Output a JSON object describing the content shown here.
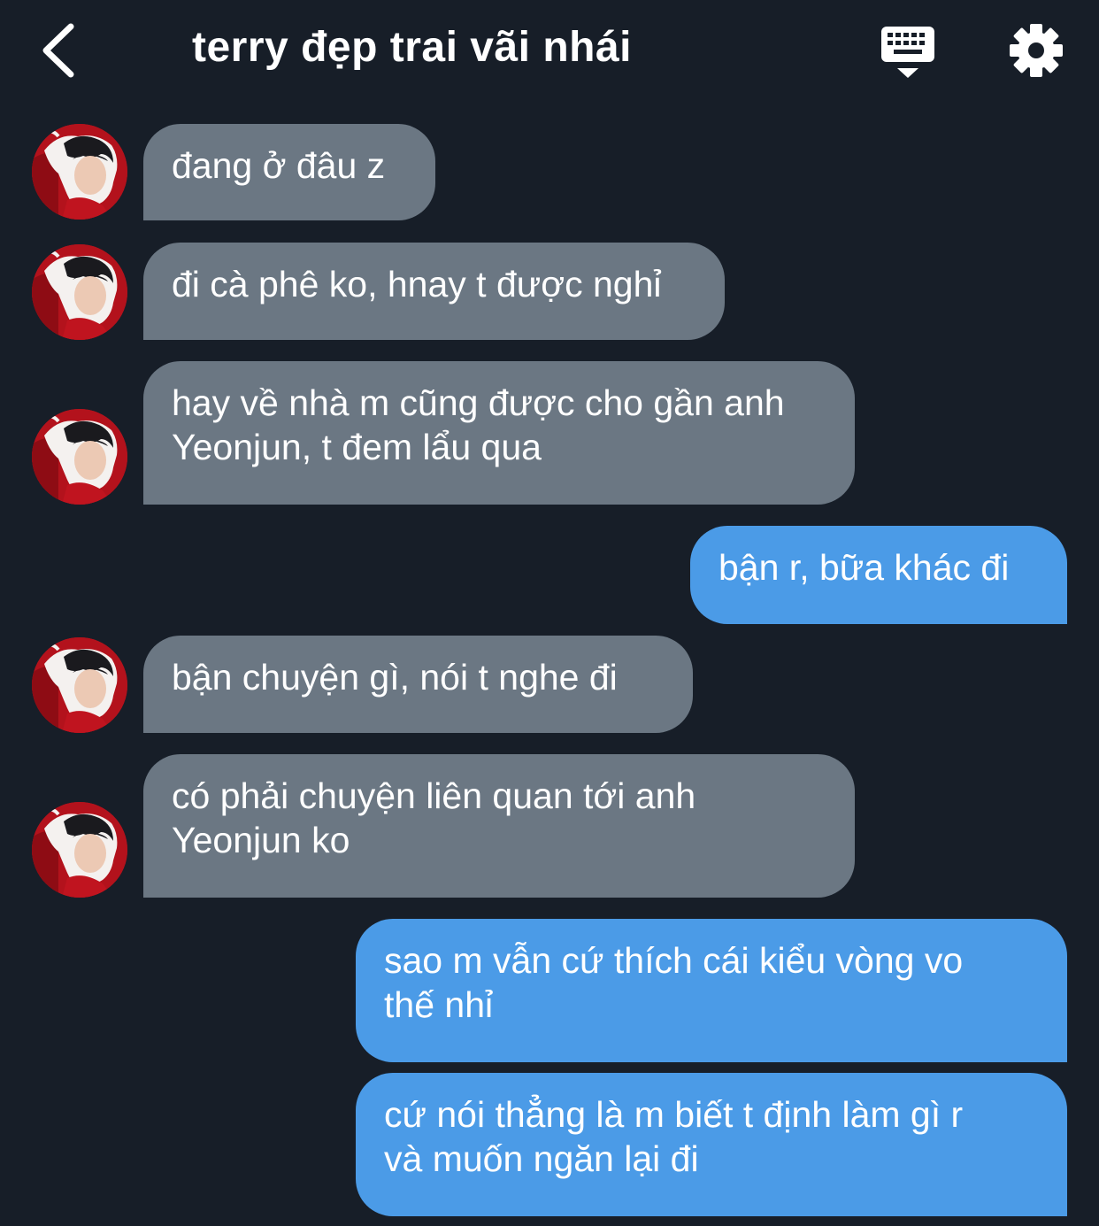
{
  "header": {
    "title": "terry đẹp trai vãi nhái",
    "back_icon": "chevron-left-icon",
    "keyboard_icon": "keyboard-icon",
    "settings_icon": "gear-icon"
  },
  "colors": {
    "background": "#171e28",
    "incoming_bubble": "#6b7783",
    "outgoing_bubble": "#4b9be7",
    "text": "#ffffff"
  },
  "messages": [
    {
      "direction": "incoming",
      "text": "đang ở đâu z"
    },
    {
      "direction": "incoming",
      "text": "đi cà phê ko, hnay t được nghỉ"
    },
    {
      "direction": "incoming",
      "text": "hay về nhà m cũng được cho gần anh\nYeonjun, t đem lẩu qua"
    },
    {
      "direction": "outgoing",
      "text": "bận r, bữa khác đi"
    },
    {
      "direction": "incoming",
      "text": "bận chuyện gì, nói t nghe đi"
    },
    {
      "direction": "incoming",
      "text": "có phải chuyện liên quan tới anh\nYeonjun ko"
    },
    {
      "direction": "outgoing",
      "text": "sao m vẫn cứ thích cái kiểu vòng vo\nthế nhỉ"
    },
    {
      "direction": "outgoing",
      "text": "cứ nói thẳng là m biết t định làm gì r\nvà muốn ngăn lại đi"
    }
  ]
}
